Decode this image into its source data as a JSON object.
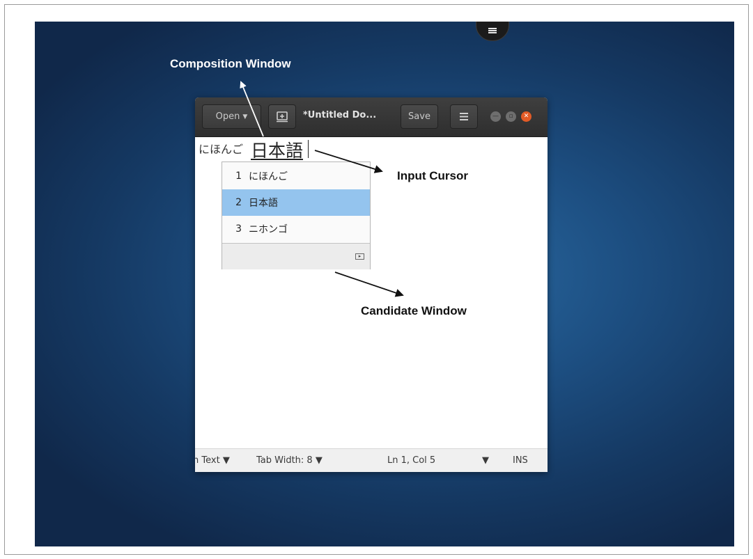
{
  "editor_window": {
    "open_label": "Open",
    "title": "*Untitled Do...",
    "save_label": "Save"
  },
  "document": {
    "preedit_text": "にほんご",
    "composition_text": "日本語"
  },
  "candidate_window": {
    "items": [
      {
        "index": "1",
        "text": "にほんご",
        "selected": false
      },
      {
        "index": "2",
        "text": "日本語",
        "selected": true
      },
      {
        "index": "3",
        "text": "ニホンゴ",
        "selected": false
      }
    ]
  },
  "statusbar": {
    "language": "n Text",
    "tab_width": "Tab Width: 8",
    "position": "Ln 1, Col 5",
    "mode": "INS"
  },
  "annotations": {
    "composition_window": "Composition Window",
    "input_cursor": "Input Cursor",
    "candidate_window": "Candidate Window"
  },
  "colors": {
    "desktop": "#1d4f82",
    "headerbar": "#363636",
    "selected_candidate": "#94c4ee",
    "close_button": "#e35b26"
  },
  "icons": [
    "hamburger-menu-icon",
    "caret-down-icon",
    "new-tab-icon",
    "minimize-icon",
    "maximize-icon",
    "close-icon",
    "expand-icon"
  ]
}
